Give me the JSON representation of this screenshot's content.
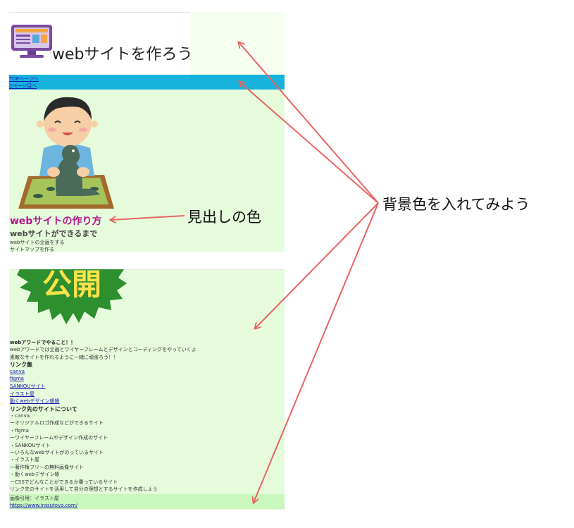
{
  "site": {
    "title": "webサイトを作ろう",
    "nav": [
      "TOPページへ",
      "2ページ目へ"
    ],
    "heading_main": "webサイトの作り方",
    "heading_sub": "webサイトができるまで",
    "steps": [
      "webサイトの企画をする",
      "サイトマップを作る"
    ]
  },
  "page2": {
    "sign_text": "公開",
    "lines": [
      {
        "text": "webアワードでやること！！",
        "style": "bold"
      },
      {
        "text": "webアワードでは企画とワイヤーフレームとデザインとコーディングをやっていくよ",
        "style": "normal"
      },
      {
        "text": "素敵なサイトを作れるように一緒に頑張ろう！！",
        "style": "normal"
      },
      {
        "text": "リンク集",
        "style": "h"
      },
      {
        "text": "canva",
        "style": "link"
      },
      {
        "text": "figma",
        "style": "link"
      },
      {
        "text": "SANKOUサイト",
        "style": "link"
      },
      {
        "text": "イラスト屋",
        "style": "link"
      },
      {
        "text": "動くwebデザイン帳帳",
        "style": "link"
      },
      {
        "text": "リンク先のサイトについて",
        "style": "h"
      },
      {
        "text": "・canva",
        "style": "normal"
      },
      {
        "text": "ーオリジナルロゴ作成などができるサイト",
        "style": "normal"
      },
      {
        "text": "・figma",
        "style": "normal"
      },
      {
        "text": "ーワイヤーフレームやデザイン作成のサイト",
        "style": "normal"
      },
      {
        "text": "・SANKOUサイト",
        "style": "normal"
      },
      {
        "text": "ーいろんなwebサイトがのっているサイト",
        "style": "normal"
      },
      {
        "text": "・イラスト屋",
        "style": "normal"
      },
      {
        "text": "ー著作権フリーの無料画像サイト",
        "style": "normal"
      },
      {
        "text": "・動くwebデザイン帳",
        "style": "normal"
      },
      {
        "text": "ーCSSでどんなことができるか乗っているサイト",
        "style": "normal"
      },
      {
        "text": "リンク先のサイトを活用して自分の理想とするサイトを作成しよう",
        "style": "normal"
      }
    ],
    "credit": "画像引用：イラスト屋",
    "credit_url": "https://www.irasutoya.com/"
  },
  "annotations": {
    "heading_color": "見出しの色",
    "background_color": "背景色を入れてみよう"
  },
  "colors": {
    "panel_bg": "#e6fbdc",
    "nav_bg": "#17b3dc",
    "heading": "#b2138c",
    "arrow": "#e86460",
    "footer_bg": "#c9f7bd"
  },
  "icons": [
    "computer-monitor-icon",
    "boy-with-clay-dinosaur-illustration",
    "kokai-starburst-sign-icon"
  ]
}
